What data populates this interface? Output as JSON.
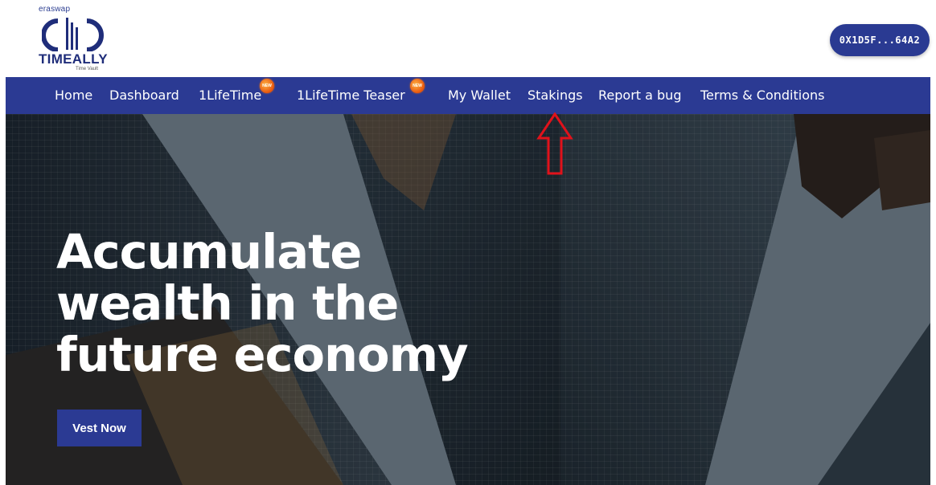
{
  "brand": {
    "top_text_a": "era",
    "top_text_b": "swap",
    "name": "TIMEALLY",
    "tagline": "Time Vault"
  },
  "header": {
    "wallet_address": "0X1D5F...64A2"
  },
  "nav": {
    "items": [
      {
        "label": "Home"
      },
      {
        "label": "Dashboard"
      },
      {
        "label": "1LifeTime",
        "badge": "NEW"
      },
      {
        "label": "1LifeTime Teaser",
        "badge": "NEW"
      },
      {
        "label": "My Wallet"
      },
      {
        "label": "Stakings"
      },
      {
        "label": "Report a bug"
      },
      {
        "label": "Terms & Conditions"
      }
    ]
  },
  "hero": {
    "title_lines": [
      "Accumulate",
      "wealth in the",
      "future economy"
    ],
    "cta_label": "Vest Now"
  },
  "colors": {
    "primary": "#2b3a93",
    "annotation": "#e0121b"
  }
}
